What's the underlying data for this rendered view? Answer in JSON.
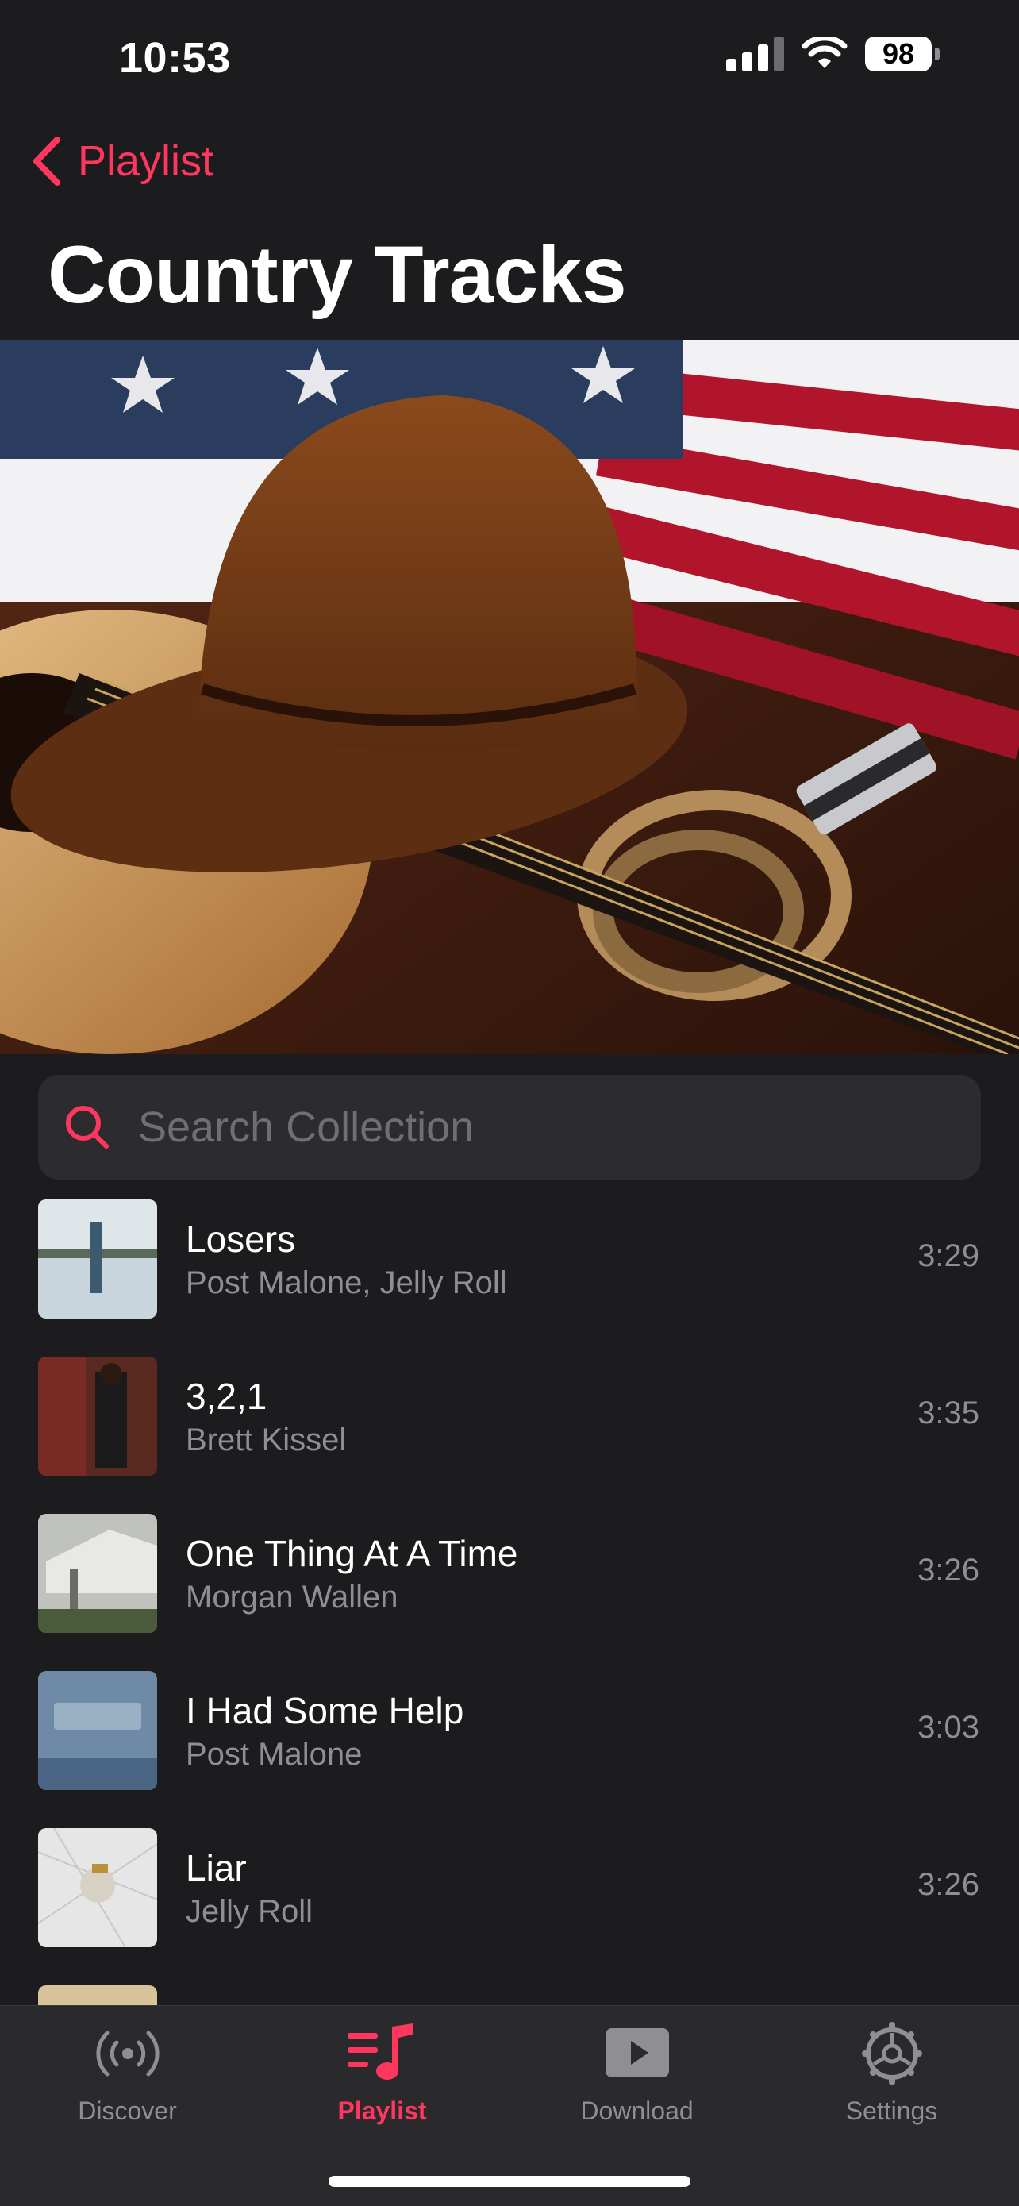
{
  "status_bar": {
    "time": "10:53",
    "battery": "98"
  },
  "nav": {
    "back_label": "Playlist",
    "title": "Country Tracks"
  },
  "search": {
    "placeholder": "Search Collection"
  },
  "tracks": [
    {
      "title": "Losers",
      "artist": "Post Malone, Jelly Roll",
      "duration": "3:29"
    },
    {
      "title": "3,2,1",
      "artist": "Brett Kissel",
      "duration": "3:35"
    },
    {
      "title": "One Thing At A Time",
      "artist": "Morgan Wallen",
      "duration": "3:26"
    },
    {
      "title": "I Had Some Help",
      "artist": "Post Malone",
      "duration": "3:03"
    },
    {
      "title": "Liar",
      "artist": "Jelly Roll",
      "duration": "3:26"
    }
  ],
  "tab_bar": [
    {
      "label": "Discover",
      "icon": "broadcast-icon"
    },
    {
      "label": "Playlist",
      "icon": "playlist-icon",
      "active": true
    },
    {
      "label": "Download",
      "icon": "play-square-icon"
    },
    {
      "label": "Settings",
      "icon": "gear-icon"
    }
  ],
  "colors": {
    "accent": "#ff375f",
    "background": "#1c1c1e"
  }
}
